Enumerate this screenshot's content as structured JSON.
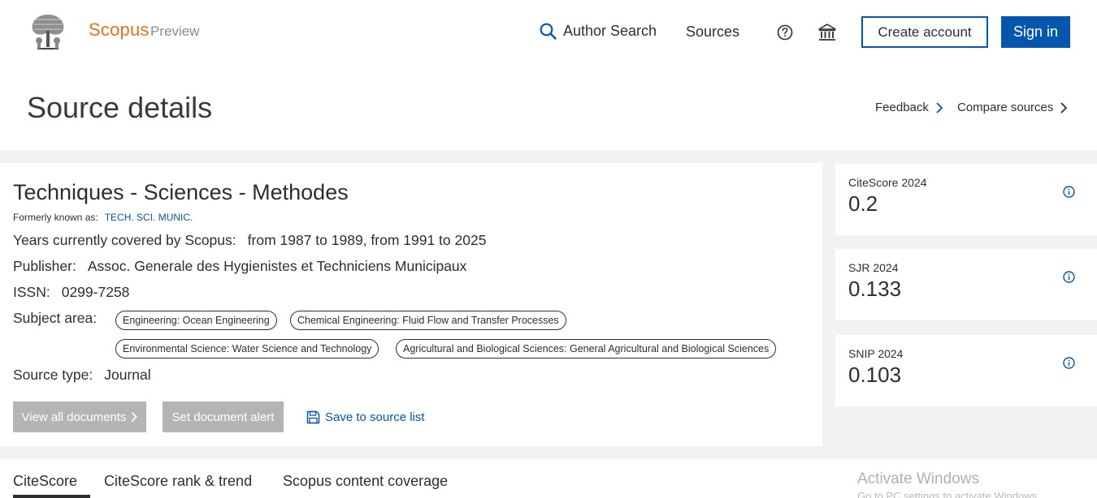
{
  "header": {
    "brand": "Scopus",
    "brand_sub": "Preview",
    "author_search": "Author Search",
    "sources": "Sources",
    "create_account": "Create account",
    "sign_in": "Sign in"
  },
  "page": {
    "title": "Source details",
    "feedback": "Feedback",
    "compare": "Compare sources"
  },
  "source": {
    "title": "Techniques - Sciences - Methodes",
    "formerly_label": "Formerly known as:",
    "formerly_value": "TECH. SCI. MUNIC.",
    "years_label": "Years currently covered by Scopus:",
    "years_value": "from 1987 to 1989, from 1991 to 2025",
    "publisher_label": "Publisher:",
    "publisher_value": "Assoc. Generale des Hygienistes et Techniciens Municipaux",
    "issn_label": "ISSN:",
    "issn_value": "0299-7258",
    "subject_label": "Subject area:",
    "subjects": [
      "Engineering: Ocean Engineering",
      "Chemical Engineering: Fluid Flow and Transfer Processes",
      "Environmental Science: Water Science and Technology",
      "Agricultural and Biological Sciences: General Agricultural and Biological Sciences"
    ],
    "type_label": "Source type:",
    "type_value": "Journal"
  },
  "actions": {
    "view_all": "View all documents",
    "set_alert": "Set document alert",
    "save": "Save to source list"
  },
  "metrics": [
    {
      "label": "CiteScore 2024",
      "value": "0.2"
    },
    {
      "label": "SJR 2024",
      "value": "0.133"
    },
    {
      "label": "SNIP 2024",
      "value": "0.103"
    }
  ],
  "tabs": [
    "CiteScore",
    "CiteScore rank & trend",
    "Scopus content coverage"
  ],
  "watermark": {
    "title": "Activate Windows",
    "sub": "Go to PC settings to activate Windows."
  },
  "colors": {
    "accent": "#0656ad",
    "brand": "#e9711c",
    "disabled": "#b4b4b4"
  },
  "icons": [
    "elsevier-logo-icon",
    "search-icon",
    "help-icon",
    "institution-icon",
    "chevron-right-icon",
    "save-icon",
    "info-icon"
  ]
}
